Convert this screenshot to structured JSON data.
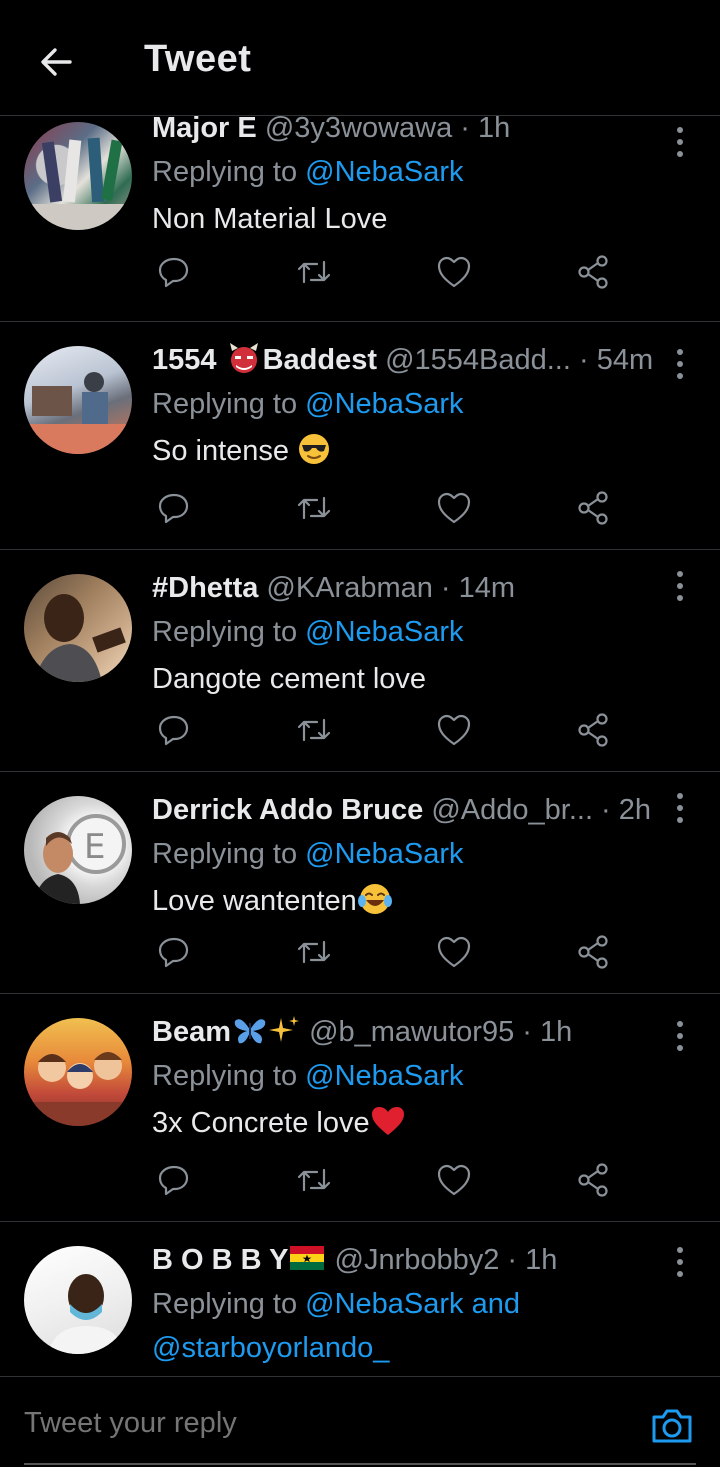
{
  "header": {
    "title": "Tweet"
  },
  "tweets": [
    {
      "name": "Major E",
      "handle": "@3y3wowawa",
      "dot": " · ",
      "time": "1h",
      "replying_prefix": "Replying to ",
      "mention": "@NebaSark",
      "mention2": "",
      "text": "Non Material Love"
    },
    {
      "name": "1554",
      "name_suffix": "Baddest",
      "handle": "@1554Badd...",
      "dot": " · ",
      "time": "54m",
      "replying_prefix": "Replying to ",
      "mention": "@NebaSark",
      "text": "So intense "
    },
    {
      "name": "#Dhetta",
      "handle": "@KArabman",
      "dot": " · ",
      "time": "14m",
      "replying_prefix": "Replying to ",
      "mention": "@NebaSark",
      "text": "Dangote cement love"
    },
    {
      "name": "Derrick Addo Bruce",
      "handle": "@Addo_br...",
      "dot": " · ",
      "time": "2h",
      "replying_prefix": "Replying to ",
      "mention": "@NebaSark",
      "text": "Love wantenten"
    },
    {
      "name": "Beam",
      "handle": "@b_mawutor95",
      "dot": " · ",
      "time": "1h",
      "replying_prefix": "Replying to ",
      "mention": "@NebaSark",
      "text": "3x Concrete love"
    },
    {
      "name": "B O B B Y",
      "handle": "@Jnrbobby2",
      "dot": " · ",
      "time": "1h",
      "replying_prefix": "Replying to ",
      "mention": "@NebaSark",
      "and": " and",
      "mention2": "@starboyorlando_"
    }
  ],
  "composer": {
    "placeholder": "Tweet your reply"
  },
  "colors": {
    "background": "#000000",
    "accent": "#1d9bf0",
    "muted": "#8b9198",
    "divider": "#2f3336"
  },
  "icons": [
    "back-arrow-icon",
    "more-vertical-icon",
    "reply-icon",
    "retweet-icon",
    "like-icon",
    "share-icon",
    "camera-icon"
  ]
}
